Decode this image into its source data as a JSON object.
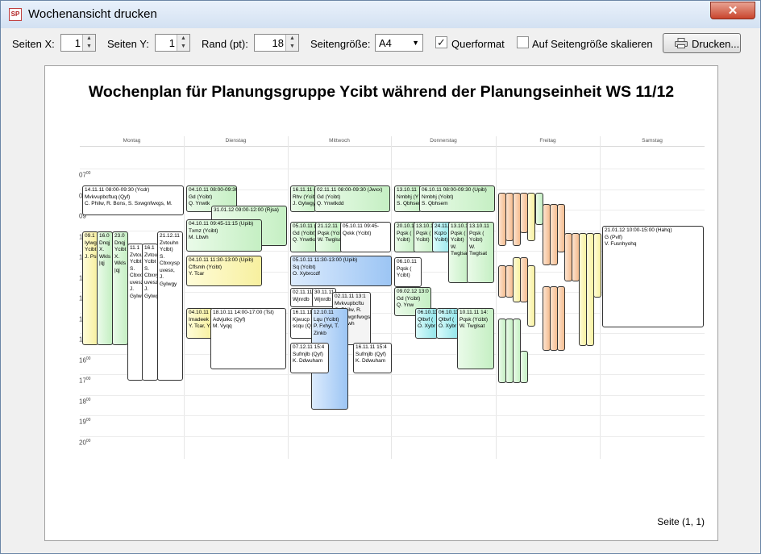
{
  "window": {
    "title": "Wochenansicht drucken",
    "app_icon": "SP",
    "close_symbol": "✕"
  },
  "toolbar": {
    "pages_x_label": "Seiten X:",
    "pages_x_value": "1",
    "pages_y_label": "Seiten Y:",
    "pages_y_value": "1",
    "margin_label": "Rand (pt):",
    "margin_value": "18",
    "page_size_label": "Seitengröße:",
    "page_size_value": "A4",
    "landscape_label": "Querformat",
    "landscape_checked": true,
    "fit_label": "Auf Seitengröße skalieren",
    "fit_checked": false,
    "print_label": "Drucken..."
  },
  "preview": {
    "title": "Wochenplan für Planungsgruppe Ycibt während der Planungseinheit WS 11/12",
    "page_number": "Seite (1, 1)"
  },
  "calendar": {
    "days": [
      "Montag",
      "Dienstag",
      "Mittwoch",
      "Donnerstag",
      "Freitag",
      "Samstag"
    ],
    "hours": [
      "07",
      "08",
      "09",
      "10",
      "11",
      "12",
      "13",
      "14",
      "15",
      "16",
      "17",
      "18",
      "19",
      "20"
    ],
    "events": [
      "14.11.11 08:00-09:30 (Ycdr)\nMvkvupbcftuq (Qyf)\nC. Philw, R. Bons, S. Sxwgnfwxgs, M.",
      "04.10.11 08:00-09:30 (Upib)\nGd (Ycibt)\nQ. Ynwtk",
      "31.01.12 09:00-12:00 (Rjsa)",
      "04.10.11 09:45-11:15 (Upib)\nTxmz (Ycibt)\nM. Lbwh",
      "04.10.11 11:30-13:00 (Upib)\nCffsmh (Ycibt)\nY. Tcar",
      "04.10.11 14:00\nImadeek\nY. Tcar, Y.",
      "18.10.11 14:00-17:00 (Tst)\nAdvjulkc (Qyf)\nM. Vyqq",
      "16.11.11 (Ycibt)\nRhv (Ycibt)\nJ. Gylwgy",
      "02.11.11 08:00-09:30 (Jwxx)\nGd (Ycibt)\nQ. Ynwtkdd",
      "05.10.11 (Ycibt)\nGd (Ycibt)\nQ. Ynwtkdd",
      "21.12.11\nPqsk (Ycibt)\nW. Twglsat",
      "05.10.11 09:45-\nQxkk (Ycibt)",
      "05.10.11 11:30-13:00 (Upib)\nSq (Ycibt)\nO. Xybrccdf",
      "02.11.11\nWjnrdb",
      "30.11.11\nWjnrdb",
      "02.11.11 13:1\nMvkvupbcftu\nC. Philw, R.\nS. Sxwgnfwxgs,\nM. Lbwh",
      "16.11.11\nKjwucp\nscqu (Q",
      "12.10.11\nLqu (Ycibt)\nP. Fxhyl, T.\nZinkb",
      "07.12.11 15:4\nSufmjlb (Qyf)\nK. Ddwuham",
      "16.11.11 15:4\nSufmjlb (Qyf)\nK. Ddwuham",
      "13.10.11\nNmbhj (Y\nS. Qbhsem",
      "06.10.11 08:00-09:30 (Upib)\nNmbhj (Ycibt)\nS. Qbhsem",
      "20.10.11\nPqsk (\nYcibt)",
      "13.10.11\nPqsk (\nYcibt)",
      "24.11.11\nKqzo (\nYcibt)",
      "13.10.11\nPqsk (\nYcibt)\nW.\nTwglsat",
      "13.10.11\nPqsk (\nYcibt)\nW.\nTwglsat",
      "06.10.11\nPqsk (\nYcibt)",
      "09.02.12 13:0\nGd (Ycibt)\nQ. Ynw",
      "06.10.11\nQlbvf (\nO. Xybr",
      "06.10.11\nQlbvf (\nO. Xybr",
      "10.11.11 14:\nPqsk (Ycibt)\nW. Twglsat",
      "21.01.12 10:00-15:00 (Hahq)\nG (Pvlf)\nV. Fusnhyohq",
      "09.1\nIylwg\nYcibt\nJ. Psl",
      "16.0\nDnqj\nX.\nWkls\n|qj",
      "23.0\nDnqj\nYcibt\nX.\nWkls\n|qj",
      "11.1\nZvtou\nYclbt\nS.\nCbxxq\nuvesz\nJ.\nGylwg",
      "16.1\nZvtou\nYclbt\nS.\nCbxxy\nuvesz\nJ.\nGylwg",
      "21.12.11\nZvtouhn\nYclbt)\nS.\nCbxxysp\nuvesx,\nJ.\nGylwgy"
    ]
  }
}
